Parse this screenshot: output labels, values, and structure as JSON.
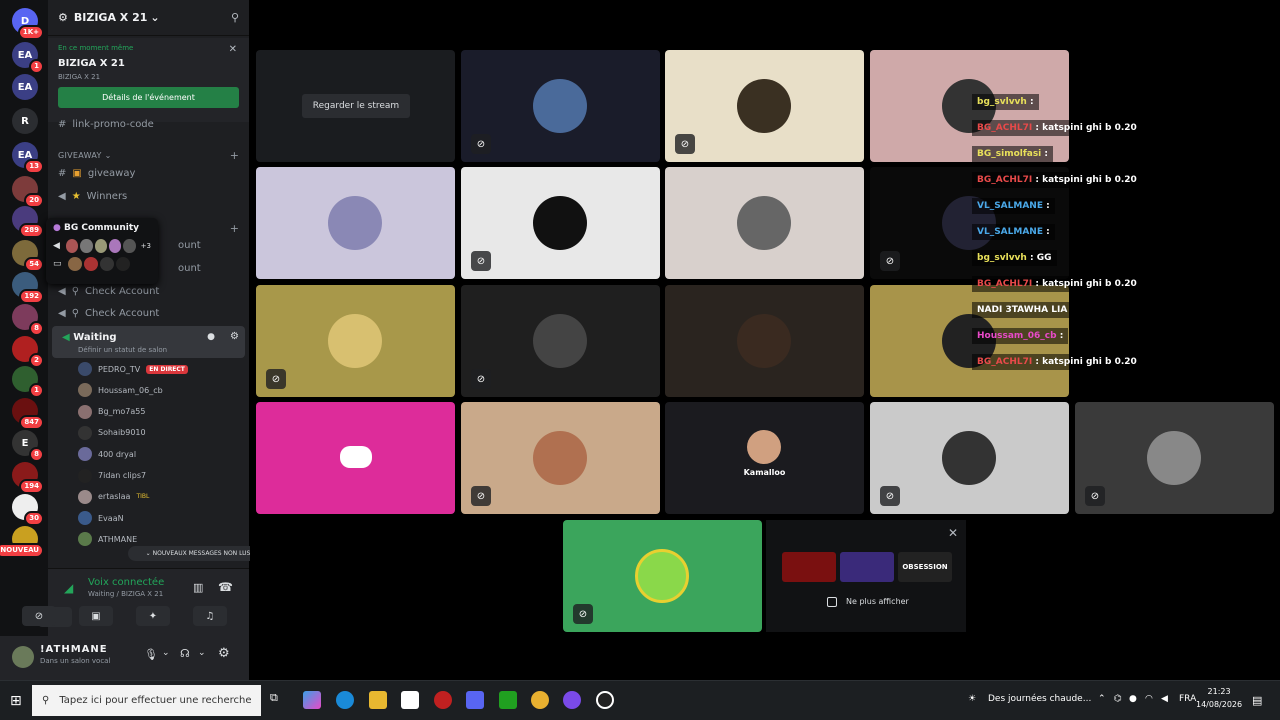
{
  "rail": {
    "servers": [
      {
        "abbr": "D",
        "badge": "1K+",
        "color": "#5865f2"
      },
      {
        "abbr": "EA",
        "badge": "1",
        "color": "#3b3f85"
      },
      {
        "abbr": "EA",
        "badge": "",
        "color": "#3b3f85"
      },
      {
        "abbr": "R",
        "badge": "",
        "color": "#2b2d31"
      },
      {
        "abbr": "EA",
        "badge": "13",
        "color": "#3b3f85"
      },
      {
        "abbr": "",
        "badge": "20",
        "color": "#7d3b3b"
      },
      {
        "abbr": "",
        "badge": "289",
        "color": "#4a3b7d"
      },
      {
        "abbr": "",
        "badge": "54",
        "color": "#7d6a3b"
      },
      {
        "abbr": "",
        "badge": "192",
        "color": "#3b5c7d"
      },
      {
        "abbr": "",
        "badge": "8",
        "color": "#7d3b5c"
      },
      {
        "abbr": "",
        "badge": "2",
        "color": "#b02020"
      },
      {
        "abbr": "",
        "badge": "1",
        "color": "#2f5f2f"
      },
      {
        "abbr": "",
        "badge": "847",
        "color": "#6a1010"
      },
      {
        "abbr": "E",
        "badge": "8",
        "color": "#333"
      },
      {
        "abbr": "",
        "badge": "194",
        "color": "#8a1a1a"
      },
      {
        "abbr": "",
        "badge": "30",
        "color": "#eee"
      },
      {
        "abbr": "",
        "badge": "NOUVEAU",
        "color": "#c9a020"
      }
    ]
  },
  "server": {
    "name": "BIZIGA X 21"
  },
  "event": {
    "live_label": "En ce moment même",
    "title": "BIZIGA X 21",
    "location": "BIZIGA X 21",
    "button": "Détails de l'événement"
  },
  "channels": {
    "promo": "link-promo-code",
    "category_giveaway": "GIVEAWAY",
    "giveaway": "giveaway",
    "winners": "Winners",
    "check1": "Check Account",
    "check2": "Check Account",
    "ghost1": "ount",
    "ghost2": "ount",
    "waiting": "Waiting",
    "waiting_status": "Définir un statut de salon"
  },
  "popup": {
    "title": "BG Community",
    "more": "+3"
  },
  "voice_users": [
    {
      "name": "PEDRO_TV",
      "live": "EN DIRECT"
    },
    {
      "name": "Houssam_06_cb",
      "live": ""
    },
    {
      "name": "Bg_mo7a55",
      "live": ""
    },
    {
      "name": "Sohaib9010",
      "live": ""
    },
    {
      "name": "400 dryal",
      "live": ""
    },
    {
      "name": "7idan clips7",
      "live": ""
    },
    {
      "name": "ertaslaa",
      "live": "",
      "tag": "TIBL"
    },
    {
      "name": "EvaaN",
      "live": ""
    },
    {
      "name": "ATHMANE",
      "live": ""
    }
  ],
  "unread_label": "NOUVEAUX MESSAGES NON LUS",
  "voice_panel": {
    "status": "Voix connectée",
    "location": "Waiting / BIZIGA X 21"
  },
  "user_panel": {
    "name": "!ATHMANE",
    "status": "Dans un salon vocal"
  },
  "stage": {
    "stream_button": "Regarder le stream",
    "named_tile": "Kamalloo",
    "tiles": [
      {
        "bg": "#1a1c1f",
        "avatar": "#2b3440",
        "muted": false
      },
      {
        "bg": "#1a1c2a",
        "avatar": "#4a6a9a",
        "muted": true
      },
      {
        "bg": "#e8dfc8",
        "avatar": "#3a3022",
        "muted": true
      },
      {
        "bg": "#cfa9a9",
        "avatar": "#333",
        "muted": false
      },
      {
        "bg": "#cbc6dc",
        "avatar": "#8a88b5",
        "muted": false
      },
      {
        "bg": "#e8e8e8",
        "avatar": "#111",
        "muted": true
      },
      {
        "bg": "#d8d0cc",
        "avatar": "#666",
        "muted": false
      },
      {
        "bg": "#0a0a0a",
        "avatar": "#223",
        "muted": true
      },
      {
        "bg": "#a8984a",
        "avatar": "#d8c070",
        "muted": true
      },
      {
        "bg": "#1f1f1f",
        "avatar": "#444",
        "muted": true
      },
      {
        "bg": "#2a241f",
        "avatar": "#3a2a20",
        "muted": false
      },
      {
        "bg": "#a8944a",
        "avatar": "#222",
        "muted": false
      },
      {
        "bg": "#dd2c9a",
        "avatar": "#fff",
        "muted": false
      },
      {
        "bg": "#c9a98a",
        "avatar": "#b07050",
        "muted": true
      },
      {
        "bg": "#1b1b1f",
        "avatar": "#d0a080",
        "muted": false
      },
      {
        "bg": "#cacaca",
        "avatar": "#333",
        "muted": true
      },
      {
        "bg": "#3a3a3a",
        "avatar": "#888",
        "muted": true
      }
    ]
  },
  "chat": [
    {
      "user": "bg_svlvvh",
      "msg": "",
      "color": "#e8e05a"
    },
    {
      "user": "BG_ACHL7I",
      "msg": "katspini ghi b 0.20",
      "color": "#e84a4a"
    },
    {
      "user": "BG_simolfasi",
      "msg": "",
      "color": "#e8e05a"
    },
    {
      "user": "BG_ACHL7I",
      "msg": "katspini ghi b 0.20",
      "color": "#e84a4a"
    },
    {
      "user": "VL_SALMANE",
      "msg": "",
      "color": "#4aa8e8"
    },
    {
      "user": "VL_SALMANE",
      "msg": "",
      "color": "#4aa8e8"
    },
    {
      "user": "bg_svlvvh",
      "msg": "GG",
      "color": "#e8e05a"
    },
    {
      "user": "BG_ACHL7I",
      "msg": "katspini ghi b 0.20",
      "color": "#e84a4a"
    },
    {
      "user": "",
      "msg": "NADI 3TAWHA LIA",
      "color": "#e84a4a"
    },
    {
      "user": "Houssam_06_cb",
      "msg": "",
      "color": "#e84ac8"
    },
    {
      "user": "BG_ACHL7I",
      "msg": "katspini ghi b 0.20",
      "color": "#e84a4a"
    }
  ],
  "promo": {
    "checkbox_label": "Ne plus afficher",
    "thumbs": [
      "#7a1010",
      "#3a2a7a",
      "#222"
    ],
    "thumb3_label": "OBSESSION"
  },
  "taskbar": {
    "search_placeholder": "Tapez ici pour effectuer une recherche",
    "weather": "Des journées chaude...",
    "lang": "FRA",
    "time": "21:23",
    "date": "14/08/2026"
  }
}
